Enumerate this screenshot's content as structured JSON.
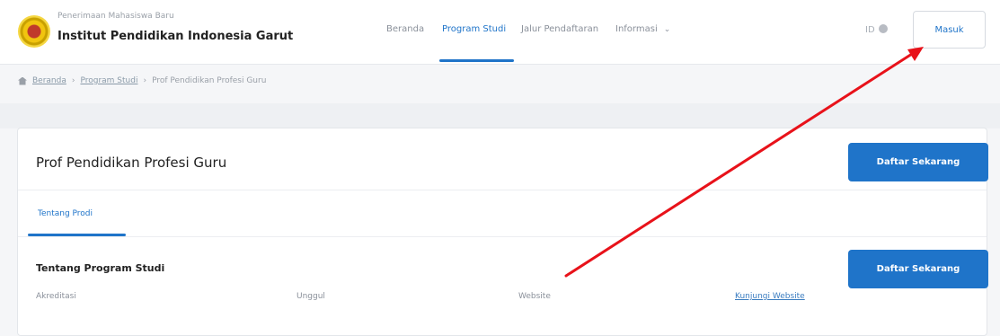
{
  "header": {
    "subtitle": "Penerimaan Mahasiswa Baru",
    "institution": "Institut Pendidikan Indonesia Garut",
    "nav": [
      {
        "label": "Beranda"
      },
      {
        "label": "Program Studi"
      },
      {
        "label": "Jalur Pendaftaran"
      },
      {
        "label": "Informasi"
      }
    ],
    "language": "ID",
    "login_label": "Masuk"
  },
  "breadcrumb": {
    "home": "Beranda",
    "program": "Program Studi",
    "current": "Prof Pendidikan Profesi Guru"
  },
  "card": {
    "title": "Prof Pendidikan Profesi Guru",
    "register_label": "Daftar Sekarang",
    "tab_label": "Tentang Prodi",
    "section_title": "Tentang Program Studi",
    "section_register_label": "Daftar Sekarang",
    "accreditation_label": "Akreditasi",
    "accreditation_value": "Unggul",
    "website_label": "Website",
    "website_link": "Kunjungi Website"
  },
  "colors": {
    "primary": "#1f74c9",
    "annotation_arrow": "#e8121a"
  },
  "icons": [
    "logo-emblem",
    "globe-icon",
    "chevron-down-icon",
    "home-icon"
  ]
}
